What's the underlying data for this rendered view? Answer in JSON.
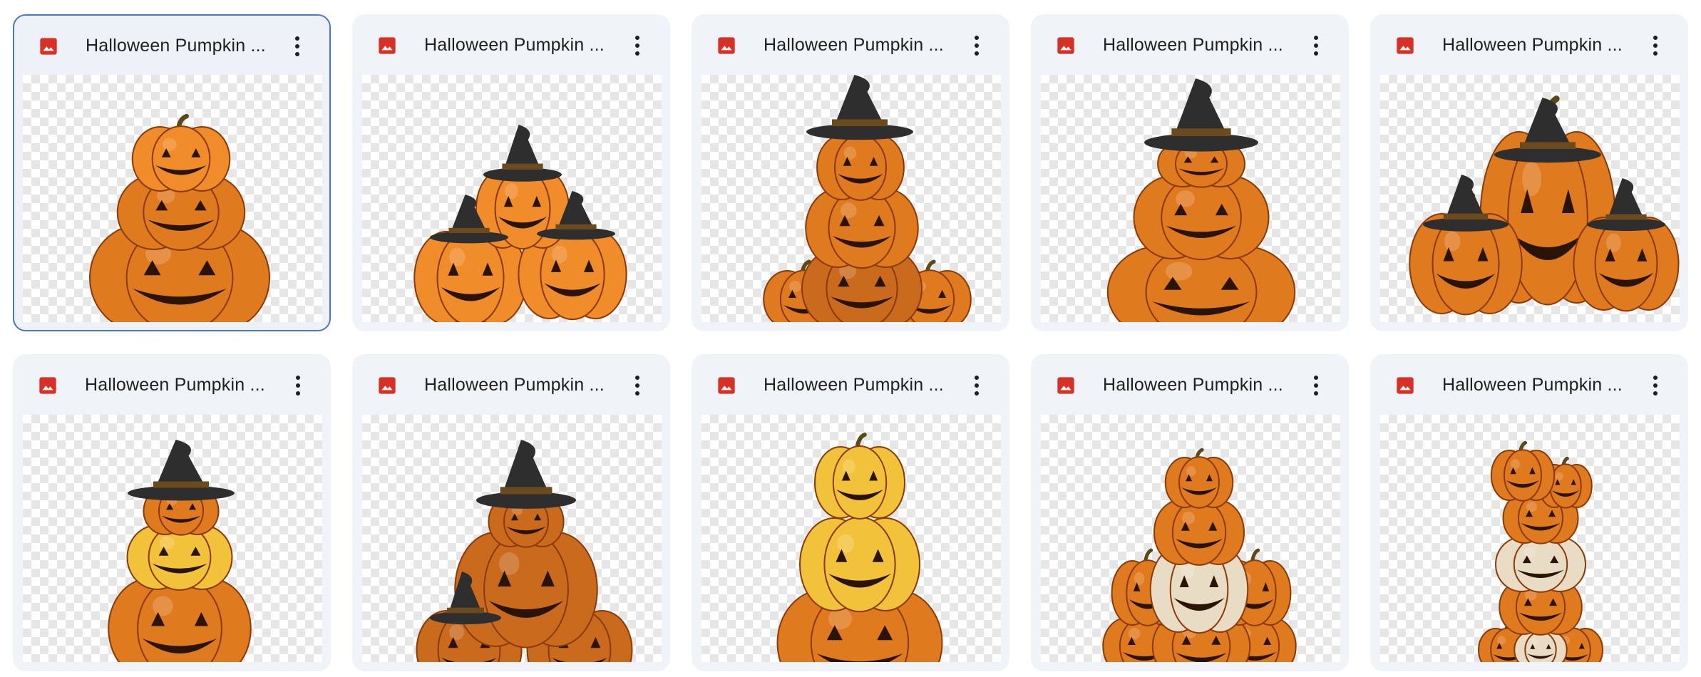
{
  "files": [
    {
      "title": "Halloween Pumpkin ...",
      "selected": true,
      "art": "stack3"
    },
    {
      "title": "Halloween Pumpkin ...",
      "selected": false,
      "art": "trio-hats"
    },
    {
      "title": "Halloween Pumpkin ...",
      "selected": false,
      "art": "scarecrow"
    },
    {
      "title": "Halloween Pumpkin ...",
      "selected": false,
      "art": "stack-hat"
    },
    {
      "title": "Halloween Pumpkin ...",
      "selected": false,
      "art": "family-hats"
    },
    {
      "title": "Halloween Pumpkin ...",
      "selected": false,
      "art": "stack-yellow"
    },
    {
      "title": "Halloween Pumpkin ...",
      "selected": false,
      "art": "big-hat-pile"
    },
    {
      "title": "Halloween Pumpkin ...",
      "selected": false,
      "art": "cartoon-stack"
    },
    {
      "title": "Halloween Pumpkin ...",
      "selected": false,
      "art": "pyramid-white"
    },
    {
      "title": "Halloween Pumpkin ...",
      "selected": false,
      "art": "tall-pyramid"
    }
  ],
  "icons": {
    "file_type": "image-file-icon",
    "more": "more-vert-icon"
  },
  "colors": {
    "card_bg": "#f0f4f9",
    "selected_border": "#4a77c9",
    "image_icon": "#d93025",
    "pumpkin": "#e07a1f",
    "pumpkin_dark": "#a8480b",
    "hat": "#2e2e2e"
  }
}
